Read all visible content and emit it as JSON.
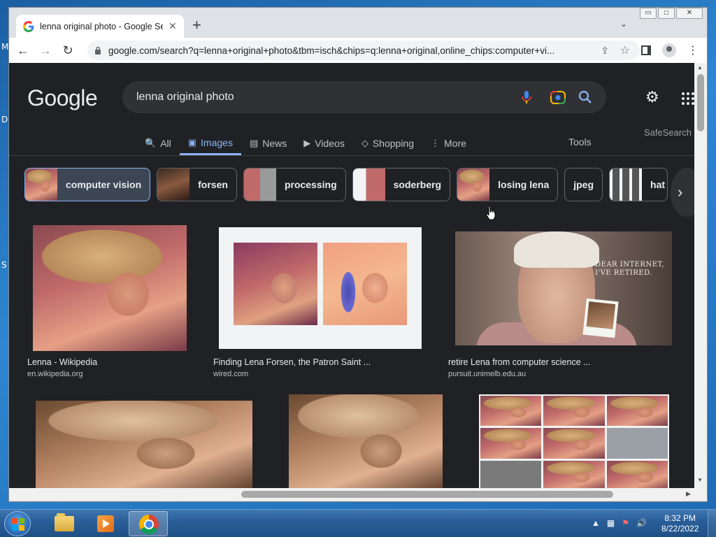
{
  "desktop": {
    "side_letters": [
      "M",
      "D",
      "S"
    ]
  },
  "browser": {
    "tab": {
      "title": "lenna original photo - Google Se...",
      "close": "✕"
    },
    "new_tab": "+",
    "tab_search": "⌄",
    "window_controls": {
      "minimize": "▭",
      "maximize": "□",
      "close": "✕"
    },
    "nav": {
      "back": "←",
      "forward": "→",
      "reload": "↻"
    },
    "url": "google.com/search?q=lenna+original+photo&tbm=isch&chips=q:lenna+original,online_chips:computer+vi...",
    "share": "⇪",
    "star": "☆",
    "menu": "⋮"
  },
  "google": {
    "logo": "Google",
    "query": "lenna original photo",
    "tabs": [
      {
        "icon": "🔍",
        "label": "All"
      },
      {
        "icon": "▣",
        "label": "Images"
      },
      {
        "icon": "▤",
        "label": "News"
      },
      {
        "icon": "▶",
        "label": "Videos"
      },
      {
        "icon": "◇",
        "label": "Shopping"
      },
      {
        "icon": "⋮",
        "label": "More"
      }
    ],
    "tools": "Tools",
    "safesearch": "SafeSearch",
    "chips": [
      "computer vision",
      "forsen",
      "processing",
      "soderberg",
      "losing lena",
      "jpeg",
      "hat"
    ],
    "chip_next": "›",
    "results": [
      {
        "title": "Lenna - Wikipedia",
        "source": "en.wikipedia.org"
      },
      {
        "title": "Finding Lena Forsen, the Patron Saint ...",
        "source": "wired.com"
      },
      {
        "title": "retire Lena from computer science ...",
        "source": "pursuit.unimelb.edu.au"
      },
      {
        "title": "",
        "source": ""
      },
      {
        "title": "",
        "source": ""
      },
      {
        "title": "",
        "source": ""
      }
    ],
    "retire_image_text": [
      "DEAR INTERNET,",
      "I'VE RETIRED."
    ]
  },
  "taskbar": {
    "time": "8:32 PM",
    "date": "8/22/2022",
    "tray_up": "▲",
    "volume": "🔊"
  }
}
